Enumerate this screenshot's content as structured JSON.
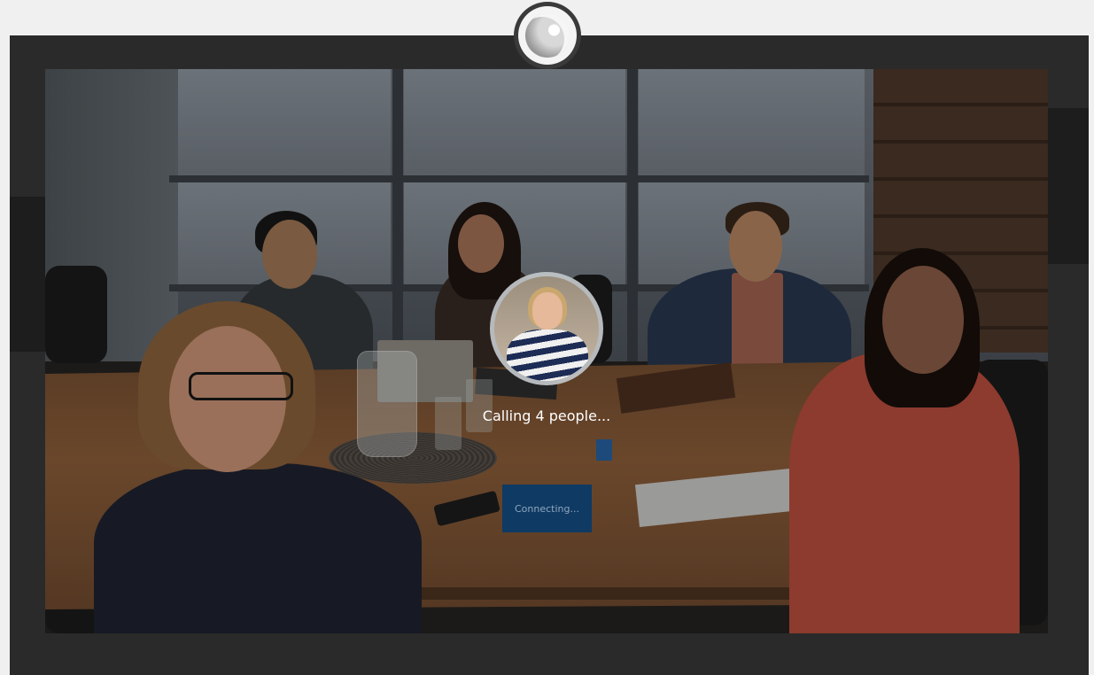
{
  "call": {
    "status_text": "Calling 4 people...",
    "button_label": "Connecting..."
  },
  "colors": {
    "bezel": "#2a2a2a",
    "button_bg": "#0f3a63",
    "progress_indicator": "#1d4a7a"
  },
  "icons": {
    "camera": "webcam-lens-icon"
  }
}
